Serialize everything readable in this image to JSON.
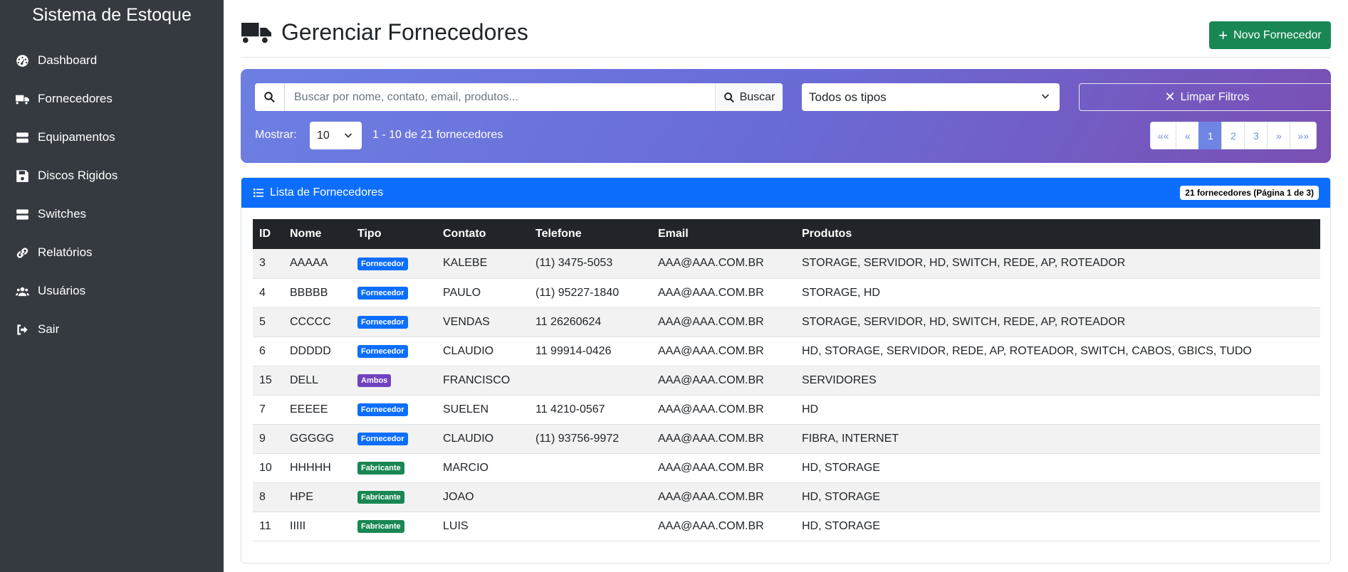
{
  "sidebar": {
    "brand": "Sistema de Estoque",
    "items": [
      {
        "label": "Dashboard",
        "icon": "dashboard-icon"
      },
      {
        "label": "Fornecedores",
        "icon": "truck-icon"
      },
      {
        "label": "Equipamentos",
        "icon": "server-icon"
      },
      {
        "label": "Discos Rigidos",
        "icon": "save-icon"
      },
      {
        "label": "Switches",
        "icon": "server-icon"
      },
      {
        "label": "Relatórios",
        "icon": "link-icon"
      },
      {
        "label": "Usuários",
        "icon": "users-icon"
      },
      {
        "label": "Sair",
        "icon": "sign-out-icon"
      }
    ]
  },
  "header": {
    "title": "Gerenciar Fornecedores",
    "new_button": "Novo Fornecedor"
  },
  "filters": {
    "search_placeholder": "Buscar por nome, contato, email, produtos...",
    "search_button": "Buscar",
    "type_selected": "Todos os tipos",
    "clear_button": "Limpar Filtros",
    "show_label": "Mostrar:",
    "per_page": "10",
    "range_info": "1 - 10 de 21 fornecedores"
  },
  "pagination": {
    "first": "««",
    "prev": "«",
    "pages": [
      "1",
      "2",
      "3"
    ],
    "next": "»",
    "last": "»»",
    "current": "1"
  },
  "card": {
    "title": "Lista de Fornecedores",
    "count_badge": "21 fornecedores (Página 1 de 3)"
  },
  "table": {
    "headers": [
      "ID",
      "Nome",
      "Tipo",
      "Contato",
      "Telefone",
      "Email",
      "Produtos"
    ],
    "rows": [
      {
        "id": "3",
        "nome": "AAAAA",
        "tipo": "Fornecedor",
        "contato": "KALEBE",
        "telefone": "(11) 3475-5053",
        "email": "AAA@AAA.COM.BR",
        "produtos": "STORAGE, SERVIDOR, HD, SWITCH, REDE, AP, ROTEADOR"
      },
      {
        "id": "4",
        "nome": "BBBBB",
        "tipo": "Fornecedor",
        "contato": "PAULO",
        "telefone": "(11) 95227-1840",
        "email": "AAA@AAA.COM.BR",
        "produtos": "STORAGE, HD"
      },
      {
        "id": "5",
        "nome": "CCCCC",
        "tipo": "Fornecedor",
        "contato": "VENDAS",
        "telefone": "11 26260624",
        "email": "AAA@AAA.COM.BR",
        "produtos": "STORAGE, SERVIDOR, HD, SWITCH, REDE, AP, ROTEADOR"
      },
      {
        "id": "6",
        "nome": "DDDDD",
        "tipo": "Fornecedor",
        "contato": "CLAUDIO",
        "telefone": "11 99914-0426",
        "email": "AAA@AAA.COM.BR",
        "produtos": "HD, STORAGE, SERVIDOR, REDE, AP, ROTEADOR, SWITCH, CABOS, GBICS, TUDO"
      },
      {
        "id": "15",
        "nome": "DELL",
        "tipo": "Ambos",
        "contato": "FRANCISCO",
        "telefone": "",
        "email": "AAA@AAA.COM.BR",
        "produtos": "SERVIDORES"
      },
      {
        "id": "7",
        "nome": "EEEEE",
        "tipo": "Fornecedor",
        "contato": "SUELEN",
        "telefone": "11 4210-0567",
        "email": "AAA@AAA.COM.BR",
        "produtos": "HD"
      },
      {
        "id": "9",
        "nome": "GGGGG",
        "tipo": "Fornecedor",
        "contato": "CLAUDIO",
        "telefone": "(11) 93756-9972",
        "email": "AAA@AAA.COM.BR",
        "produtos": "FIBRA, INTERNET"
      },
      {
        "id": "10",
        "nome": "HHHHH",
        "tipo": "Fabricante",
        "contato": "MARCIO",
        "telefone": "",
        "email": "AAA@AAA.COM.BR",
        "produtos": "HD, STORAGE"
      },
      {
        "id": "8",
        "nome": "HPE",
        "tipo": "Fabricante",
        "contato": "JOAO",
        "telefone": "",
        "email": "AAA@AAA.COM.BR",
        "produtos": "HD, STORAGE"
      },
      {
        "id": "11",
        "nome": "IIIII",
        "tipo": "Fabricante",
        "contato": "LUIS",
        "telefone": "",
        "email": "AAA@AAA.COM.BR",
        "produtos": "HD, STORAGE"
      }
    ]
  },
  "colors": {
    "sidebar_bg": "#343a40",
    "primary": "#0d6efd",
    "success": "#198754",
    "badge_fornecedor": "#0d6efd",
    "badge_ambos": "#6f42c1",
    "badge_fabricante": "#198754"
  }
}
